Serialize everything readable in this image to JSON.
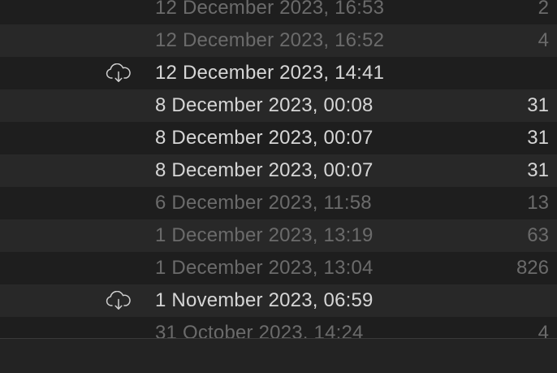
{
  "rows": [
    {
      "date": "12 December 2023, 16:53",
      "count": "2",
      "cloud": false,
      "dim": true
    },
    {
      "date": "12 December 2023, 16:52",
      "count": "4",
      "cloud": false,
      "dim": true
    },
    {
      "date": "12 December 2023, 14:41",
      "count": "",
      "cloud": true,
      "dim": false
    },
    {
      "date": "8 December 2023, 00:08",
      "count": "31",
      "cloud": false,
      "dim": false
    },
    {
      "date": "8 December 2023, 00:07",
      "count": "31",
      "cloud": false,
      "dim": false
    },
    {
      "date": "8 December 2023, 00:07",
      "count": "31",
      "cloud": false,
      "dim": false
    },
    {
      "date": "6 December 2023, 11:58",
      "count": "13",
      "cloud": false,
      "dim": true
    },
    {
      "date": "1 December 2023, 13:19",
      "count": "63",
      "cloud": false,
      "dim": true
    },
    {
      "date": "1 December 2023, 13:04",
      "count": "826",
      "cloud": false,
      "dim": true
    },
    {
      "date": "1 November 2023, 06:59",
      "count": "",
      "cloud": true,
      "dim": false
    },
    {
      "date": "31 October 2023, 14:24",
      "count": "4",
      "cloud": false,
      "dim": true
    }
  ],
  "icons": {
    "cloud": "cloud-download-icon"
  },
  "colors": {
    "background": "#1e1e1e",
    "row_alt": "#282828",
    "text_bright": "#d6d6d6",
    "text_dim": "#6b6b6b"
  }
}
